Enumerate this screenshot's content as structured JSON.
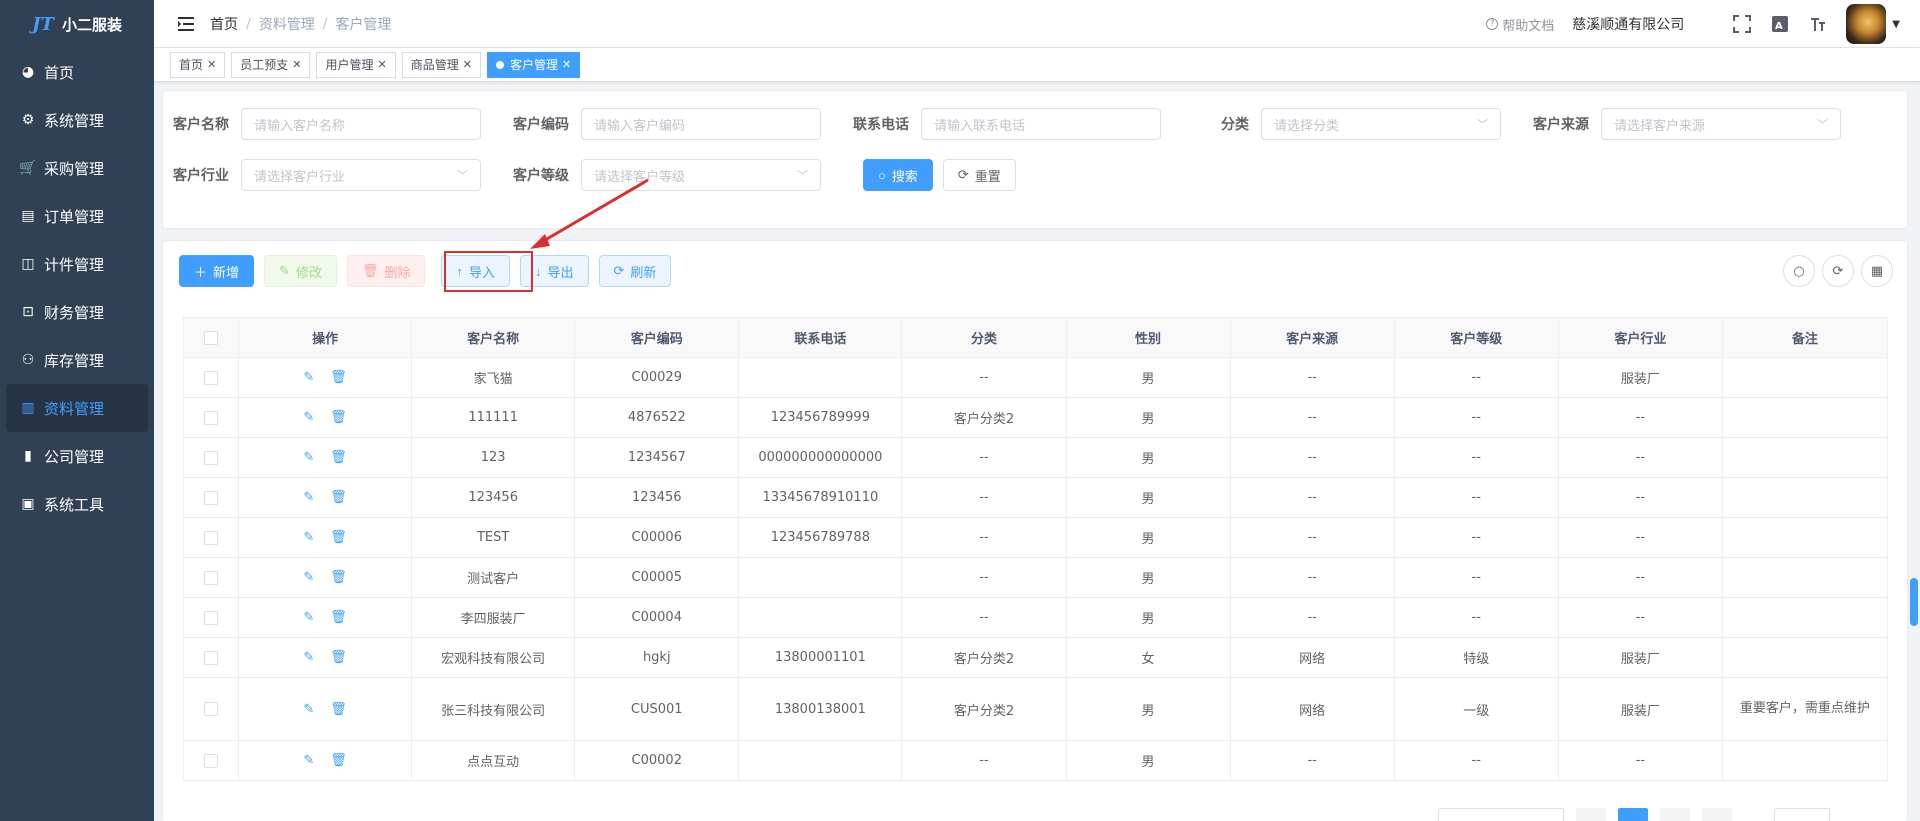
{
  "logo": {
    "mark": "JT",
    "title": "小二服装"
  },
  "sidebar": {
    "items": [
      {
        "icon": "◕",
        "label": "首页"
      },
      {
        "icon": "⚙",
        "label": "系统管理"
      },
      {
        "icon": "🛒",
        "label": "采购管理"
      },
      {
        "icon": "▤",
        "label": "订单管理"
      },
      {
        "icon": "◫",
        "label": "计件管理"
      },
      {
        "icon": "⊡",
        "label": "财务管理"
      },
      {
        "icon": "⚇",
        "label": "库存管理"
      },
      {
        "icon": "▥",
        "label": "资料管理"
      },
      {
        "icon": "▮",
        "label": "公司管理"
      },
      {
        "icon": "▣",
        "label": "系统工具"
      }
    ]
  },
  "navbar": {
    "breadcrumb": [
      "首页",
      "资料管理",
      "客户管理"
    ],
    "help": "帮助文档",
    "company": "慈溪顺通有限公司"
  },
  "tags": [
    "首页",
    "员工预支",
    "用户管理",
    "商品管理",
    "客户管理"
  ],
  "search": {
    "customer_name": {
      "label": "客户名称",
      "placeholder": "请输入客户名称"
    },
    "customer_code": {
      "label": "客户编码",
      "placeholder": "请输入客户编码"
    },
    "phone": {
      "label": "联系电话",
      "placeholder": "请输入联系电话"
    },
    "category": {
      "label": "分类",
      "placeholder": "请选择分类"
    },
    "source": {
      "label": "客户来源",
      "placeholder": "请选择客户来源"
    },
    "industry": {
      "label": "客户行业",
      "placeholder": "请选择客户行业"
    },
    "level": {
      "label": "客户等级",
      "placeholder": "请选择客户等级"
    },
    "search_btn": "搜索",
    "reset_btn": "重置"
  },
  "toolbar": {
    "add": "新增",
    "edit": "修改",
    "delete": "删除",
    "import": "导入",
    "export": "导出",
    "refresh": "刷新"
  },
  "table": {
    "headers": [
      "操作",
      "客户名称",
      "客户编码",
      "联系电话",
      "分类",
      "性别",
      "客户来源",
      "客户等级",
      "客户行业",
      "备注"
    ],
    "rows": [
      [
        "家飞猫",
        "C00029",
        "",
        "--",
        "男",
        "--",
        "--",
        "服装厂",
        ""
      ],
      [
        "111111",
        "4876522",
        "123456789999",
        "客户分类2",
        "男",
        "--",
        "--",
        "--",
        ""
      ],
      [
        "123",
        "1234567",
        "000000000000000",
        "--",
        "男",
        "--",
        "--",
        "--",
        ""
      ],
      [
        "123456",
        "123456",
        "13345678910110",
        "--",
        "男",
        "--",
        "--",
        "--",
        ""
      ],
      [
        "TEST",
        "C00006",
        "123456789788",
        "--",
        "男",
        "--",
        "--",
        "--",
        ""
      ],
      [
        "测试客户",
        "C00005",
        "",
        "--",
        "男",
        "--",
        "--",
        "--",
        ""
      ],
      [
        "李四服装厂",
        "C00004",
        "",
        "--",
        "男",
        "--",
        "--",
        "--",
        ""
      ],
      [
        "宏观科技有限公司",
        "hgkj",
        "13800001101",
        "客户分类2",
        "女",
        "网络",
        "特级",
        "服装厂",
        ""
      ],
      [
        "张三科技有限公司",
        "CUS001",
        "13800138001",
        "客户分类2",
        "男",
        "网络",
        "一级",
        "服装厂",
        "重要客户，需重点维护"
      ],
      [
        "点点互动",
        "C00002",
        "",
        "--",
        "男",
        "--",
        "--",
        "--",
        ""
      ]
    ]
  },
  "colors": {
    "primary": "#409eff",
    "sidebar": "#304156",
    "annotation": "#d9302f"
  }
}
